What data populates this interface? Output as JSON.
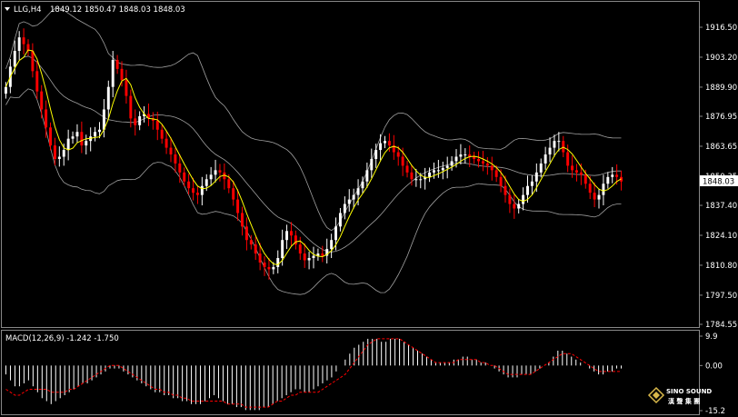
{
  "header": {
    "symbol": "LLG,H4",
    "ohlc": "1849.12 1850.47 1848.03 1848.03"
  },
  "macd_header": {
    "label": "MACD(12,26,9) -1.242 -1.750"
  },
  "current_price_label": "1848.03",
  "logo": {
    "line1": "SINO SOUND",
    "line2": "漢 聲 集 團"
  },
  "colors": {
    "background": "#000000",
    "bull": "#ffffff",
    "bear": "#ff0000",
    "ma": "#ffff00",
    "bands": "#a0a0a0",
    "histogram": "#ffffff",
    "signal": "#ff0000"
  },
  "chart_data": [
    {
      "type": "candlestick",
      "title": "LLG,H4",
      "y_ticks": [
        "1916.50",
        "1903.20",
        "1889.90",
        "1876.95",
        "1863.65",
        "1850.35",
        "1837.40",
        "1824.10",
        "1810.80",
        "1797.50",
        "1784.55"
      ],
      "ylim": [
        1784.55,
        1916.5
      ],
      "last_price": 1848.03,
      "overlays": [
        "moving-average",
        "bollinger-bands"
      ],
      "close": [
        1890,
        1899,
        1906,
        1912,
        1909,
        1906,
        1897,
        1888,
        1880,
        1872,
        1864,
        1858,
        1859,
        1862,
        1867,
        1868,
        1870,
        1864,
        1866,
        1868,
        1870,
        1871,
        1880,
        1890,
        1902,
        1898,
        1893,
        1886,
        1876,
        1873,
        1877,
        1878,
        1876,
        1875,
        1871,
        1867,
        1863,
        1860,
        1856,
        1852,
        1848,
        1845,
        1843,
        1842,
        1846,
        1849,
        1851,
        1853,
        1852,
        1849,
        1845,
        1840,
        1834,
        1828,
        1822,
        1820,
        1816,
        1812,
        1810,
        1809,
        1810,
        1814,
        1822,
        1826,
        1824,
        1820,
        1816,
        1813,
        1814,
        1815,
        1816,
        1815,
        1818,
        1822,
        1828,
        1834,
        1838,
        1840,
        1842,
        1845,
        1848,
        1853,
        1858,
        1862,
        1865,
        1866,
        1864,
        1861,
        1859,
        1855,
        1852,
        1849,
        1849,
        1849,
        1850,
        1852,
        1853,
        1853,
        1854,
        1855,
        1857,
        1859,
        1860,
        1860,
        1859,
        1858,
        1857,
        1856,
        1855,
        1853,
        1850,
        1846,
        1842,
        1838,
        1836,
        1838,
        1842,
        1846,
        1848,
        1852,
        1856,
        1860,
        1863,
        1866,
        1866,
        1861,
        1855,
        1853,
        1852,
        1851,
        1847,
        1843,
        1840,
        1842,
        1847,
        1850,
        1851,
        1850,
        1848
      ]
    },
    {
      "type": "bar+line",
      "title": "MACD(12,26,9) -1.242 -1.750",
      "y_ticks": [
        "9.9",
        "0.00",
        "-15.2"
      ],
      "ylim": [
        -15.2,
        9.9
      ],
      "series": [
        {
          "name": "MACD",
          "values": [
            -3,
            -5,
            -7,
            -7,
            -6,
            -5,
            -7,
            -9,
            -11,
            -12,
            -13,
            -12,
            -11,
            -10,
            -9,
            -8,
            -7,
            -6,
            -6,
            -5,
            -4,
            -3,
            -2,
            -1,
            -1,
            -1,
            -2,
            -3,
            -4,
            -5,
            -6,
            -7,
            -8,
            -9,
            -9,
            -10,
            -10,
            -11,
            -11,
            -12,
            -12,
            -13,
            -13,
            -13,
            -12,
            -11,
            -10,
            -11,
            -12,
            -13,
            -13,
            -14,
            -14,
            -15,
            -15,
            -15,
            -15,
            -14,
            -14,
            -13,
            -12,
            -11,
            -10,
            -9,
            -8,
            -8,
            -9,
            -9,
            -8,
            -7,
            -6,
            -5,
            -4,
            -2,
            0,
            2,
            4,
            6,
            7,
            8,
            9,
            9,
            9,
            8,
            8,
            9,
            9,
            9,
            8,
            7,
            6,
            5,
            4,
            3,
            2,
            1,
            1,
            1,
            1,
            2,
            2,
            3,
            3,
            2,
            2,
            1,
            1,
            0,
            -1,
            -2,
            -3,
            -4,
            -4,
            -4,
            -3,
            -3,
            -3,
            -2,
            -1,
            0,
            1,
            3,
            5,
            5,
            4,
            3,
            2,
            1,
            0,
            -1,
            -2,
            -3,
            -3,
            -2,
            -2,
            -1,
            -1
          ]
        },
        {
          "name": "Signal",
          "values": [
            -8,
            -9,
            -10,
            -10,
            -9,
            -8,
            -8,
            -8,
            -8,
            -8,
            -9,
            -9,
            -9,
            -9,
            -8,
            -8,
            -7,
            -6,
            -5,
            -4,
            -3,
            -2,
            -1,
            0,
            0,
            0,
            -1,
            -2,
            -3,
            -4,
            -5,
            -6,
            -7,
            -8,
            -8,
            -9,
            -9,
            -10,
            -10,
            -11,
            -11,
            -12,
            -12,
            -12,
            -12,
            -12,
            -12,
            -12,
            -12,
            -13,
            -13,
            -13,
            -13,
            -14,
            -14,
            -14,
            -14,
            -14,
            -14,
            -13,
            -12,
            -12,
            -11,
            -10,
            -10,
            -9,
            -9,
            -9,
            -9,
            -9,
            -8,
            -7,
            -6,
            -5,
            -4,
            -3,
            -1,
            1,
            3,
            5,
            7,
            8,
            9,
            9,
            9,
            9,
            9,
            9,
            8,
            7,
            6,
            5,
            4,
            3,
            2,
            1,
            1,
            1,
            1,
            1,
            2,
            2,
            2,
            2,
            2,
            1,
            1,
            0,
            0,
            -1,
            -2,
            -3,
            -3,
            -3,
            -3,
            -3,
            -3,
            -2,
            -1,
            0,
            1,
            2,
            3,
            4,
            4,
            4,
            3,
            2,
            1,
            0,
            -1,
            -2,
            -2,
            -2,
            -2,
            -2,
            -2
          ]
        }
      ]
    }
  ]
}
